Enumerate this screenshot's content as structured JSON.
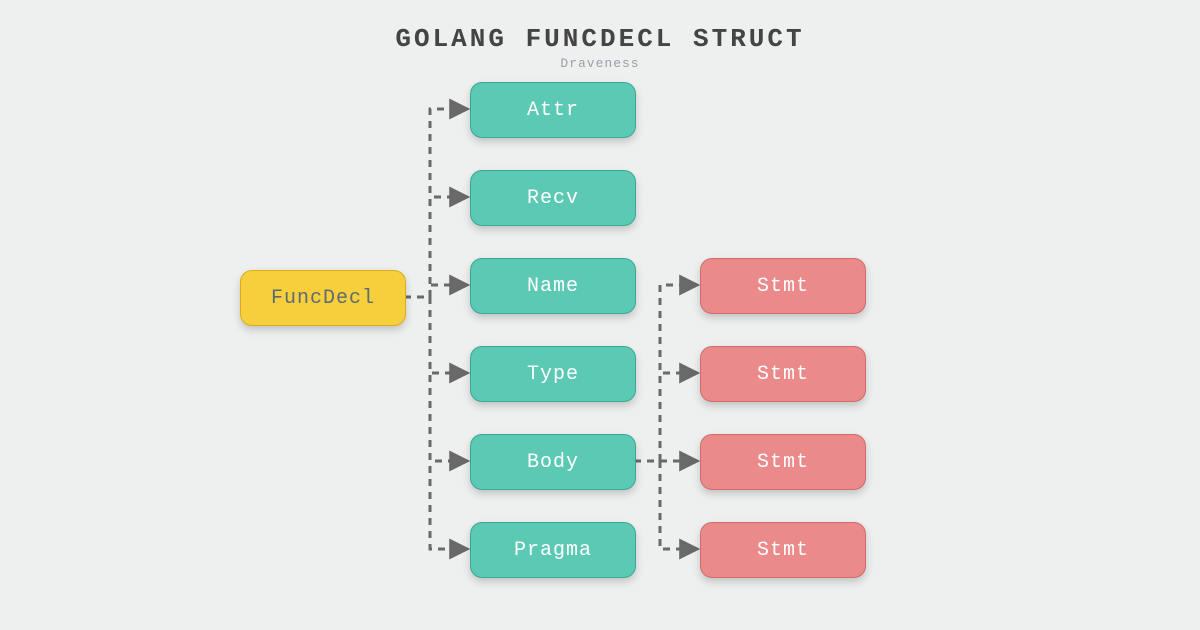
{
  "title": "GOLANG FUNCDECL STRUCT",
  "subtitle": "Draveness",
  "colors": {
    "yellow_bg": "#f7cf3c",
    "teal_bg": "#5cc9b5",
    "pink_bg": "#ea8a8a",
    "arrow": "#696969"
  },
  "root": {
    "label": "FuncDecl"
  },
  "fields": [
    {
      "key": "attr",
      "label": "Attr"
    },
    {
      "key": "recv",
      "label": "Recv"
    },
    {
      "key": "name",
      "label": "Name"
    },
    {
      "key": "type",
      "label": "Type"
    },
    {
      "key": "body",
      "label": "Body"
    },
    {
      "key": "pragma",
      "label": "Pragma"
    }
  ],
  "stmts": [
    {
      "label": "Stmt"
    },
    {
      "label": "Stmt"
    },
    {
      "label": "Stmt"
    },
    {
      "label": "Stmt"
    }
  ],
  "edges": {
    "from_root_to_fields": [
      "attr",
      "recv",
      "name",
      "type",
      "body",
      "pragma"
    ],
    "from_body_to_stmts": [
      0,
      1,
      2,
      3
    ]
  }
}
